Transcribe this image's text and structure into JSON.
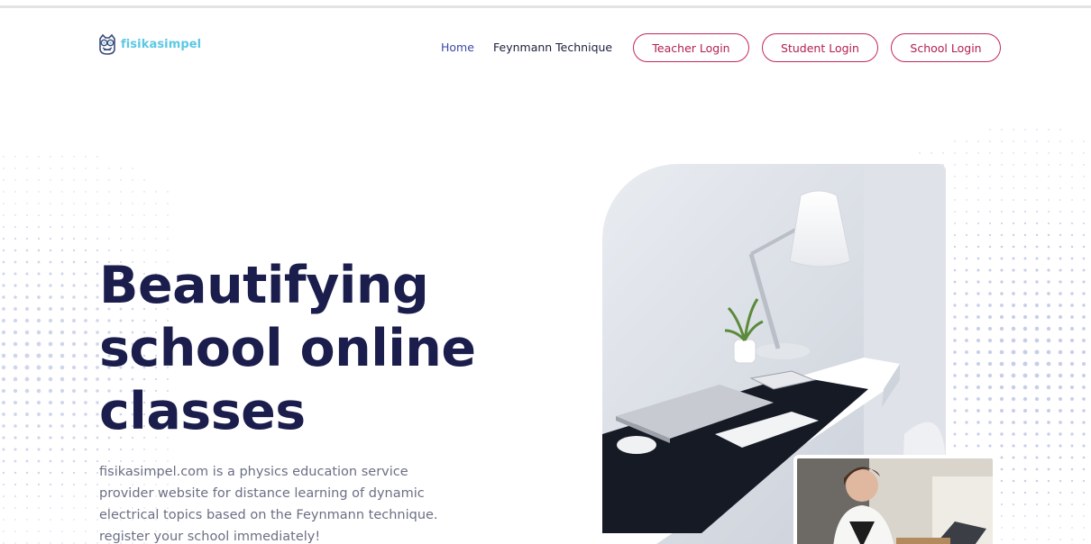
{
  "brand": {
    "name": "fisikasimpel",
    "logo_icon": "owl-logo-icon",
    "color": "#5cc8e4"
  },
  "nav": {
    "home": "Home",
    "feynmann": "Feynmann Technique",
    "active_color": "#3b48a8"
  },
  "auth": {
    "teacher": "Teacher Login",
    "student": "Student Login",
    "school": "School Login",
    "accent_color": "#c2275a"
  },
  "hero": {
    "title_lines": [
      "Beautifying",
      "school online",
      "classes"
    ],
    "description_lines": [
      "fisikasimpel.com is a physics education service",
      "provider website for distance learning of dynamic",
      "electrical topics based on the Feynmann technique.",
      "register your school immediately!"
    ],
    "title_color": "#1b1d4c"
  },
  "images": {
    "main": "desk-workspace-photo",
    "secondary": "woman-with-laptop-photo"
  }
}
